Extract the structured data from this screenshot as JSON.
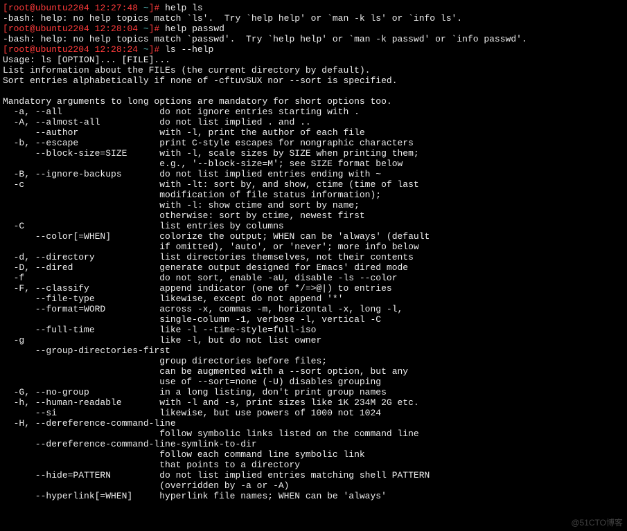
{
  "lines": [
    {
      "segs": [
        {
          "cls": "red",
          "txt": "["
        },
        {
          "cls": "red",
          "txt": "root@ubuntu2204"
        },
        {
          "cls": "white",
          "txt": " "
        },
        {
          "cls": "red",
          "txt": "12:27:48"
        },
        {
          "cls": "white",
          "txt": " "
        },
        {
          "cls": "cyan",
          "txt": "~"
        },
        {
          "cls": "red",
          "txt": "]#"
        },
        {
          "cls": "white",
          "txt": " help ls"
        }
      ]
    },
    {
      "segs": [
        {
          "cls": "white",
          "txt": "-bash: help: no help topics match `ls'.  Try `help help' or `man -k ls' or `info ls'."
        }
      ]
    },
    {
      "segs": [
        {
          "cls": "red",
          "txt": "["
        },
        {
          "cls": "red",
          "txt": "root@ubuntu2204"
        },
        {
          "cls": "white",
          "txt": " "
        },
        {
          "cls": "red",
          "txt": "12:28:04"
        },
        {
          "cls": "white",
          "txt": " "
        },
        {
          "cls": "cyan",
          "txt": "~"
        },
        {
          "cls": "red",
          "txt": "]#"
        },
        {
          "cls": "white",
          "txt": " help passwd"
        }
      ]
    },
    {
      "segs": [
        {
          "cls": "white",
          "txt": "-bash: help: no help topics match `passwd'.  Try `help help' or `man -k passwd' or `info passwd'."
        }
      ]
    },
    {
      "segs": [
        {
          "cls": "red",
          "txt": "["
        },
        {
          "cls": "red",
          "txt": "root@ubuntu2204"
        },
        {
          "cls": "white",
          "txt": " "
        },
        {
          "cls": "red",
          "txt": "12:28:24"
        },
        {
          "cls": "white",
          "txt": " "
        },
        {
          "cls": "cyan",
          "txt": "~"
        },
        {
          "cls": "red",
          "txt": "]#"
        },
        {
          "cls": "white",
          "txt": " ls --help"
        }
      ]
    },
    {
      "segs": [
        {
          "cls": "white",
          "txt": "Usage: ls [OPTION]... [FILE]..."
        }
      ]
    },
    {
      "segs": [
        {
          "cls": "white",
          "txt": "List information about the FILEs (the current directory by default)."
        }
      ]
    },
    {
      "segs": [
        {
          "cls": "white",
          "txt": "Sort entries alphabetically if none of -cftuvSUX nor --sort is specified."
        }
      ]
    },
    {
      "segs": [
        {
          "cls": "white",
          "txt": ""
        }
      ]
    },
    {
      "segs": [
        {
          "cls": "white",
          "txt": "Mandatory arguments to long options are mandatory for short options too."
        }
      ]
    },
    {
      "segs": [
        {
          "cls": "white",
          "txt": "  -a, --all                  do not ignore entries starting with ."
        }
      ]
    },
    {
      "segs": [
        {
          "cls": "white",
          "txt": "  -A, --almost-all           do not list implied . and .."
        }
      ]
    },
    {
      "segs": [
        {
          "cls": "white",
          "txt": "      --author               with -l, print the author of each file"
        }
      ]
    },
    {
      "segs": [
        {
          "cls": "white",
          "txt": "  -b, --escape               print C-style escapes for nongraphic characters"
        }
      ]
    },
    {
      "segs": [
        {
          "cls": "white",
          "txt": "      --block-size=SIZE      with -l, scale sizes by SIZE when printing them;"
        }
      ]
    },
    {
      "segs": [
        {
          "cls": "white",
          "txt": "                             e.g., '--block-size=M'; see SIZE format below"
        }
      ]
    },
    {
      "segs": [
        {
          "cls": "white",
          "txt": "  -B, --ignore-backups       do not list implied entries ending with ~"
        }
      ]
    },
    {
      "segs": [
        {
          "cls": "white",
          "txt": "  -c                         with -lt: sort by, and show, ctime (time of last"
        }
      ]
    },
    {
      "segs": [
        {
          "cls": "white",
          "txt": "                             modification of file status information);"
        }
      ]
    },
    {
      "segs": [
        {
          "cls": "white",
          "txt": "                             with -l: show ctime and sort by name;"
        }
      ]
    },
    {
      "segs": [
        {
          "cls": "white",
          "txt": "                             otherwise: sort by ctime, newest first"
        }
      ]
    },
    {
      "segs": [
        {
          "cls": "white",
          "txt": "  -C                         list entries by columns"
        }
      ]
    },
    {
      "segs": [
        {
          "cls": "white",
          "txt": "      --color[=WHEN]         colorize the output; WHEN can be 'always' (default"
        }
      ]
    },
    {
      "segs": [
        {
          "cls": "white",
          "txt": "                             if omitted), 'auto', or 'never'; more info below"
        }
      ]
    },
    {
      "segs": [
        {
          "cls": "white",
          "txt": "  -d, --directory            list directories themselves, not their contents"
        }
      ]
    },
    {
      "segs": [
        {
          "cls": "white",
          "txt": "  -D, --dired                generate output designed for Emacs' dired mode"
        }
      ]
    },
    {
      "segs": [
        {
          "cls": "white",
          "txt": "  -f                         do not sort, enable -aU, disable -ls --color"
        }
      ]
    },
    {
      "segs": [
        {
          "cls": "white",
          "txt": "  -F, --classify             append indicator (one of */=>@|) to entries"
        }
      ]
    },
    {
      "segs": [
        {
          "cls": "white",
          "txt": "      --file-type            likewise, except do not append '*'"
        }
      ]
    },
    {
      "segs": [
        {
          "cls": "white",
          "txt": "      --format=WORD          across -x, commas -m, horizontal -x, long -l,"
        }
      ]
    },
    {
      "segs": [
        {
          "cls": "white",
          "txt": "                             single-column -1, verbose -l, vertical -C"
        }
      ]
    },
    {
      "segs": [
        {
          "cls": "white",
          "txt": "      --full-time            like -l --time-style=full-iso"
        }
      ]
    },
    {
      "segs": [
        {
          "cls": "white",
          "txt": "  -g                         like -l, but do not list owner"
        }
      ]
    },
    {
      "segs": [
        {
          "cls": "white",
          "txt": "      --group-directories-first"
        }
      ]
    },
    {
      "segs": [
        {
          "cls": "white",
          "txt": "                             group directories before files;"
        }
      ]
    },
    {
      "segs": [
        {
          "cls": "white",
          "txt": "                             can be augmented with a --sort option, but any"
        }
      ]
    },
    {
      "segs": [
        {
          "cls": "white",
          "txt": "                             use of --sort=none (-U) disables grouping"
        }
      ]
    },
    {
      "segs": [
        {
          "cls": "white",
          "txt": "  -G, --no-group             in a long listing, don't print group names"
        }
      ]
    },
    {
      "segs": [
        {
          "cls": "white",
          "txt": "  -h, --human-readable       with -l and -s, print sizes like 1K 234M 2G etc."
        }
      ]
    },
    {
      "segs": [
        {
          "cls": "white",
          "txt": "      --si                   likewise, but use powers of 1000 not 1024"
        }
      ]
    },
    {
      "segs": [
        {
          "cls": "white",
          "txt": "  -H, --dereference-command-line"
        }
      ]
    },
    {
      "segs": [
        {
          "cls": "white",
          "txt": "                             follow symbolic links listed on the command line"
        }
      ]
    },
    {
      "segs": [
        {
          "cls": "white",
          "txt": "      --dereference-command-line-symlink-to-dir"
        }
      ]
    },
    {
      "segs": [
        {
          "cls": "white",
          "txt": "                             follow each command line symbolic link"
        }
      ]
    },
    {
      "segs": [
        {
          "cls": "white",
          "txt": "                             that points to a directory"
        }
      ]
    },
    {
      "segs": [
        {
          "cls": "white",
          "txt": "      --hide=PATTERN         do not list implied entries matching shell PATTERN"
        }
      ]
    },
    {
      "segs": [
        {
          "cls": "white",
          "txt": "                             (overridden by -a or -A)"
        }
      ]
    },
    {
      "segs": [
        {
          "cls": "white",
          "txt": "      --hyperlink[=WHEN]     hyperlink file names; WHEN can be 'always'"
        }
      ]
    }
  ],
  "watermark": "@51CTO博客"
}
